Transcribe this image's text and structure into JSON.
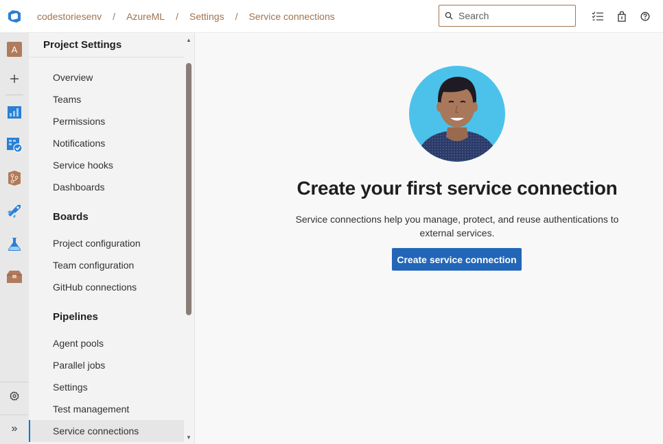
{
  "breadcrumb": [
    "codestoriesenv",
    "AzureML",
    "Settings",
    "Service connections"
  ],
  "breadcrumb_separator": "/",
  "search": {
    "placeholder": "Search"
  },
  "rail": {
    "avatar_initial": "A",
    "expand_label": "»"
  },
  "sidebar": {
    "title": "Project Settings",
    "general_items": [
      "Overview",
      "Teams",
      "Permissions",
      "Notifications",
      "Service hooks",
      "Dashboards"
    ],
    "boards": {
      "title": "Boards",
      "items": [
        "Project configuration",
        "Team configuration",
        "GitHub connections"
      ]
    },
    "pipelines": {
      "title": "Pipelines",
      "items": [
        "Agent pools",
        "Parallel jobs",
        "Settings",
        "Test management",
        "Service connections"
      ]
    },
    "selected": "Service connections"
  },
  "main": {
    "title": "Create your first service connection",
    "description": "Service connections help you manage, protect, and reuse authentications to external services.",
    "button_label": "Create service connection"
  },
  "colors": {
    "accent": "#2266b8",
    "breadcrumb": "#a0734f",
    "avatar_bg": "#4cc2ea"
  }
}
